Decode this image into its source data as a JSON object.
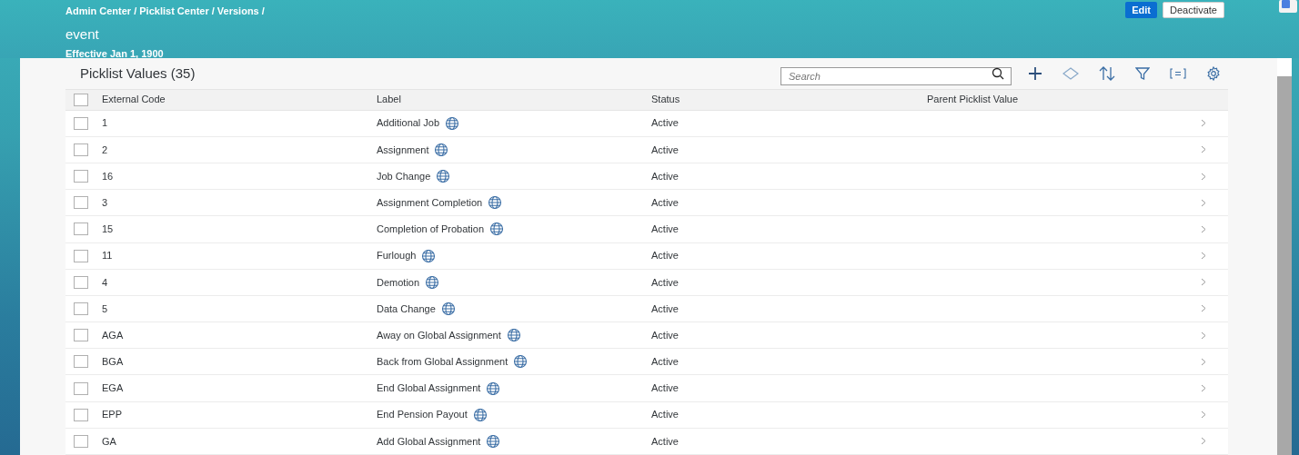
{
  "header": {
    "breadcrumb": "Admin Center / Picklist Center / Versions /",
    "title": "event",
    "subtitle": "Effective Jan 1, 1900",
    "buttons": [
      {
        "label": "Edit",
        "kind": "primary"
      },
      {
        "label": "Deactivate",
        "kind": "secondary"
      }
    ]
  },
  "table": {
    "title": "Picklist Values (35)",
    "search": {
      "placeholder": "Search"
    },
    "columns": [
      "External Code",
      "Label",
      "Status",
      "Parent Picklist Value"
    ],
    "header_checked": false,
    "rows": [
      {
        "code": "1",
        "label": "Additional Job",
        "status": "Active",
        "checked": false
      },
      {
        "code": "2",
        "label": "Assignment",
        "status": "Active",
        "checked": false
      },
      {
        "code": "16",
        "label": "Job Change",
        "status": "Active",
        "checked": false
      },
      {
        "code": "3",
        "label": "Assignment Completion",
        "status": "Active",
        "checked": false
      },
      {
        "code": "15",
        "label": "Completion of Probation",
        "status": "Active",
        "checked": false
      },
      {
        "code": "11",
        "label": "Furlough",
        "status": "Active",
        "checked": false
      },
      {
        "code": "4",
        "label": "Demotion",
        "status": "Active",
        "checked": false
      },
      {
        "code": "5",
        "label": "Data Change",
        "status": "Active",
        "checked": false
      },
      {
        "code": "AGA",
        "label": "Away on Global Assignment",
        "status": "Active",
        "checked": false
      },
      {
        "code": "BGA",
        "label": "Back from Global Assignment",
        "status": "Active",
        "checked": false
      },
      {
        "code": "EGA",
        "label": "End Global Assignment",
        "status": "Active",
        "checked": false
      },
      {
        "code": "EPP",
        "label": "End Pension Payout",
        "status": "Active",
        "checked": false
      },
      {
        "code": "GA",
        "label": "Add Global Assignment",
        "status": "Active",
        "checked": false
      }
    ]
  }
}
